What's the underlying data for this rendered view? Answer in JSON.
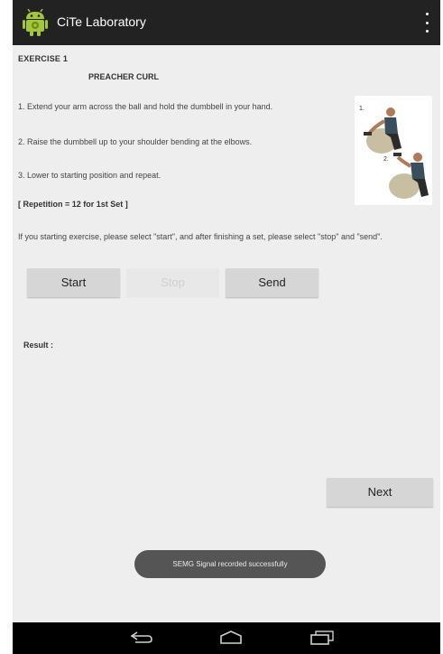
{
  "app": {
    "title": "CiTe Laboratory"
  },
  "exercise": {
    "heading": "EXERCISE 1",
    "name": "PREACHER CURL",
    "steps": [
      "1. Extend your arm across the ball and hold the dumbbell in your hand.",
      "2. Raise the dumbbell up to your shoulder bending at the elbows.",
      "3. Lower to starting position and repeat."
    ],
    "repetition": "[ Repetition = 12 for 1st Set ]",
    "instruction": "If you starting exercise, please select \"start\", and after finishing a set, please select \"stop\" and \"send\".",
    "figure_labels": [
      "1.",
      "2."
    ]
  },
  "buttons": {
    "start": "Start",
    "stop": "Stop",
    "send": "Send",
    "next": "Next"
  },
  "result": {
    "label": "Result :"
  },
  "toast": {
    "message": "SEMG Signal recorded successfully"
  },
  "icons": {
    "app": "android-icon",
    "overflow": "overflow-menu-icon",
    "back": "back-icon",
    "home": "home-icon",
    "recents": "recent-apps-icon"
  },
  "colors": {
    "action_bar": "#222222",
    "background": "#eeeeee",
    "button": "#d6d6d6",
    "toast": "#555555"
  }
}
